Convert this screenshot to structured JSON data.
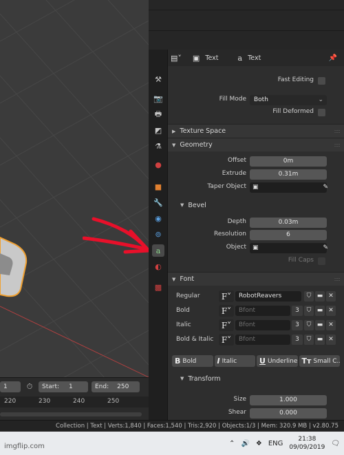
{
  "properties": {
    "header": {
      "mode_icon": "object-data-icon",
      "context_label": "Text",
      "data_label": "Text"
    },
    "shape": {
      "fast_editing_label": "Fast Editing",
      "fill_mode_label": "Fill Mode",
      "fill_mode_value": "Both",
      "fill_deformed_label": "Fill Deformed"
    },
    "sections": {
      "texture_space": "Texture Space",
      "geometry": "Geometry",
      "bevel": "Bevel",
      "font": "Font",
      "transform": "Transform"
    },
    "geometry": {
      "offset_label": "Offset",
      "offset_value": "0m",
      "extrude_label": "Extrude",
      "extrude_value": "0.31m",
      "taper_label": "Taper Object"
    },
    "bevel": {
      "depth_label": "Depth",
      "depth_value": "0.03m",
      "resolution_label": "Resolution",
      "resolution_value": "6",
      "object_label": "Object",
      "fill_caps_label": "Fill Caps"
    },
    "font": {
      "rows": [
        {
          "label": "Regular",
          "name": "RobotReavers",
          "count": ""
        },
        {
          "label": "Bold",
          "name": "Bfont",
          "count": "3"
        },
        {
          "label": "Italic",
          "name": "Bfont",
          "count": "3"
        },
        {
          "label": "Bold & Italic",
          "name": "Bfont",
          "count": "3"
        }
      ],
      "style_buttons": [
        "Bold",
        "Italic",
        "Underline",
        "Small C..."
      ]
    },
    "transform": {
      "size_label": "Size",
      "size_value": "1.000",
      "shear_label": "Shear",
      "shear_value": "0.000"
    }
  },
  "timeline": {
    "frame_value": "1",
    "start_label": "Start:",
    "start_value": "1",
    "end_label": "End:",
    "end_value": "250",
    "ticks": [
      "220",
      "230",
      "240",
      "250"
    ]
  },
  "statusbar": {
    "text": "Collection | Text | Verts:1,840 | Faces:1,540 | Tris:2,920 | Objects:1/3 | Mem: 320.9 MB | v2.80.75"
  },
  "taskbar": {
    "language": "ENG",
    "time": "21:38",
    "date": "09/09/2019"
  },
  "watermark": "imgflip.com",
  "colors": {
    "annotation_arrow": "#e8102a",
    "active_tab": "#8bd48b",
    "selection_outline": "#f0a030"
  }
}
